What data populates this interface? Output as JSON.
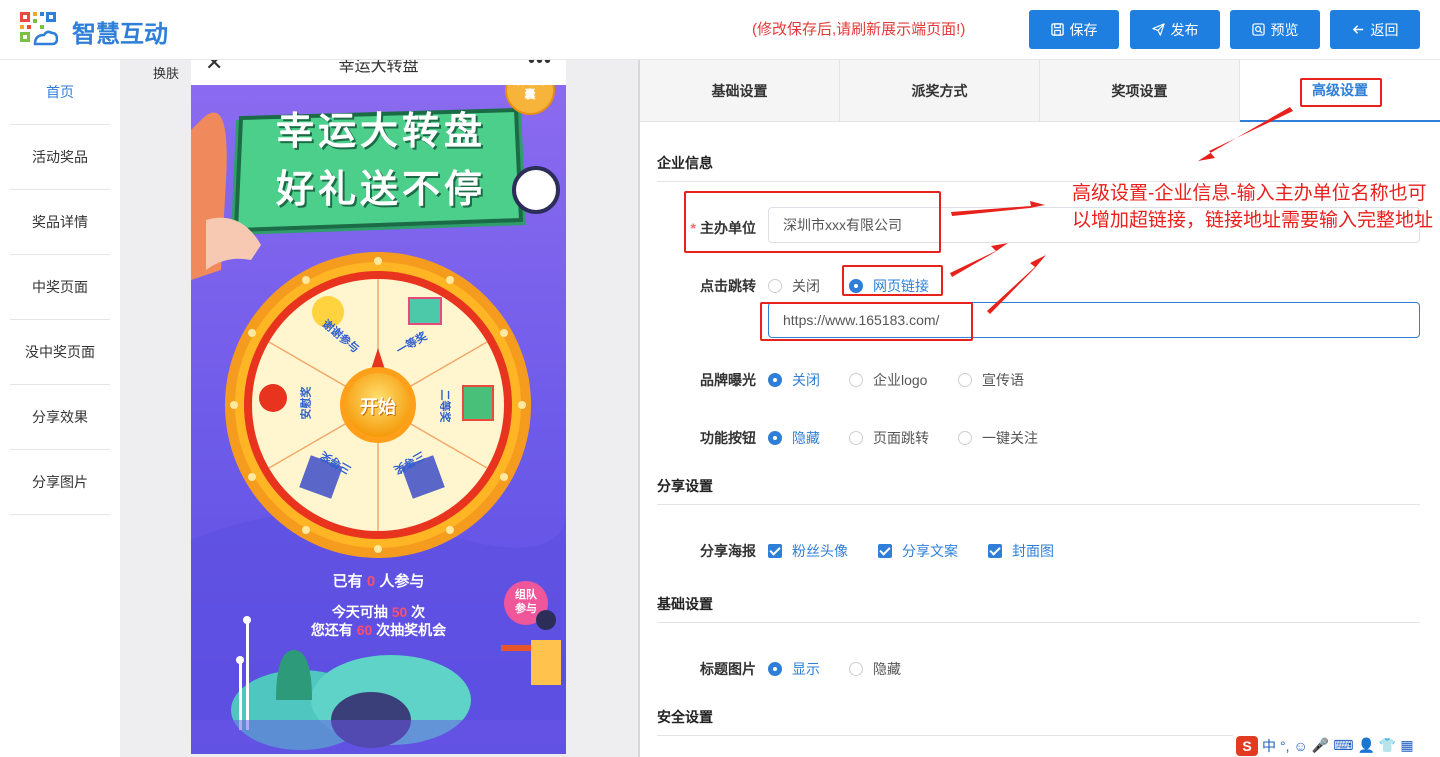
{
  "header": {
    "app_name": "智慧互动",
    "notice": "(修改保存后,请刷新展示端页面!)",
    "buttons": {
      "save": "保存",
      "publish": "发布",
      "preview": "预览",
      "back": "返回"
    }
  },
  "sidebar": {
    "items": [
      {
        "label": "首页",
        "active": true
      },
      {
        "label": "活动奖品"
      },
      {
        "label": "奖品详情"
      },
      {
        "label": "中奖页面"
      },
      {
        "label": "没中奖页面"
      },
      {
        "label": "分享效果"
      },
      {
        "label": "分享图片"
      }
    ]
  },
  "preview": {
    "skin_label": "换肤",
    "phone_title": "幸运大转盘",
    "banner_line1": "幸运大转盘",
    "banner_line2": "好礼送不停",
    "bag_badge": "活动锦囊",
    "wheel_segments": [
      "谢谢参与",
      "一等奖",
      "二等奖",
      "三等奖",
      "三等奖",
      "安慰奖"
    ],
    "start_label": "开始",
    "participants_prefix": "已有",
    "participants_count": "0",
    "participants_suffix": "人参与",
    "today_prefix": "今天可抽",
    "today_count": "50",
    "today_suffix": "次",
    "remain_prefix": "您还有",
    "remain_count": "60",
    "remain_suffix": "次抽奖机会",
    "team_badge": "组队参与"
  },
  "tabs": [
    {
      "label": "基础设置"
    },
    {
      "label": "派奖方式"
    },
    {
      "label": "奖项设置"
    },
    {
      "label": "高级设置",
      "active": true
    }
  ],
  "form": {
    "company_section": "企业信息",
    "host_label": "主办单位",
    "host_value": "深圳市xxx有限公司",
    "jump_label": "点击跳转",
    "jump_options": [
      "关闭",
      "网页链接"
    ],
    "url_value": "https://www.165183.com/",
    "brand_label": "品牌曝光",
    "brand_options": [
      "关闭",
      "企业logo",
      "宣传语"
    ],
    "func_label": "功能按钮",
    "func_options": [
      "隐藏",
      "页面跳转",
      "一键关注"
    ],
    "share_section": "分享设置",
    "poster_label": "分享海报",
    "poster_options": [
      "粉丝头像",
      "分享文案",
      "封面图"
    ],
    "basic_section": "基础设置",
    "title_img_label": "标题图片",
    "title_img_options": [
      "显示",
      "隐藏"
    ],
    "security_section": "安全设置"
  },
  "annotation": {
    "text": "高级设置-企业信息-输入主办单位名称也可以增加超链接，链接地址需要输入完整地址"
  },
  "ime": {
    "mode": "中",
    "punct": "°,"
  },
  "colors": {
    "accent": "#2f7fd8",
    "button": "#1f7fe0",
    "annotation": "#e8211d"
  }
}
